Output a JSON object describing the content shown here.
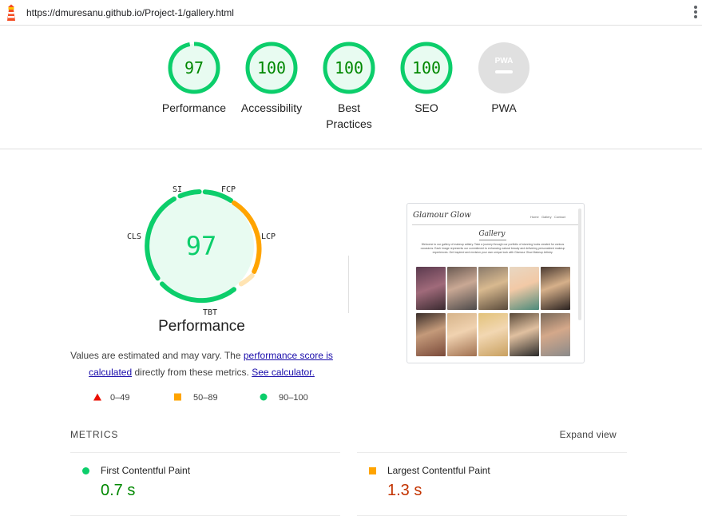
{
  "browser": {
    "url": "https://dmuresanu.github.io/Project-1/gallery.html",
    "icons": {
      "app": "lighthouse-icon",
      "menu": "kebab-menu-icon"
    }
  },
  "gauges": [
    {
      "score": "97",
      "label": "Performance",
      "fraction": 0.97,
      "type": "score"
    },
    {
      "score": "100",
      "label": "Accessibility",
      "fraction": 1.0,
      "type": "score"
    },
    {
      "score": "100",
      "label": "Best Practices",
      "fraction": 1.0,
      "type": "score"
    },
    {
      "score": "100",
      "label": "SEO",
      "fraction": 1.0,
      "type": "score"
    },
    {
      "score": "PWA",
      "label": "PWA",
      "type": "pwa"
    }
  ],
  "performance": {
    "score": "97",
    "title": "Performance",
    "metric_labels": {
      "si": "SI",
      "fcp": "FCP",
      "lcp": "LCP",
      "tbt": "TBT",
      "cls": "CLS"
    },
    "note_prefix": "Values are estimated and may vary. The ",
    "note_link1": "performance score is calculated",
    "note_middle": " directly from these metrics. ",
    "note_link2": "See calculator.",
    "legend": [
      {
        "range": "0–49",
        "shape": "triangle",
        "color": "#eb0f00"
      },
      {
        "range": "50–89",
        "shape": "square",
        "color": "#ffa400"
      },
      {
        "range": "90–100",
        "shape": "circle",
        "color": "#0cce6b"
      }
    ]
  },
  "screenshot": {
    "brand": "Glamour Glow",
    "nav": [
      "Home",
      "Gallery",
      "Contact"
    ],
    "heading": "Gallery",
    "description": "Welcome to our gallery of makeup artistry. Take a journey through our portfolio of stunning looks created for various occasions. Each image represents our commitment to enhancing natural beauty and delivering personalized makeup experiences. Get inspired and envision your own unique look with Glamour Glow Makeup Artistry."
  },
  "metrics": {
    "heading": "METRICS",
    "expand": "Expand view",
    "items": [
      {
        "name": "First Contentful Paint",
        "value": "0.7 s",
        "status": "pass"
      },
      {
        "name": "Largest Contentful Paint",
        "value": "1.3 s",
        "status": "average"
      }
    ]
  },
  "colors": {
    "pass": "#0cce6b",
    "pass_text": "#008800",
    "pass_bg": "#e8fbf1",
    "average": "#ffa400",
    "average_text": "#c33300",
    "fail": "#eb0f00",
    "pwa_gray": "#e0e0e0"
  }
}
